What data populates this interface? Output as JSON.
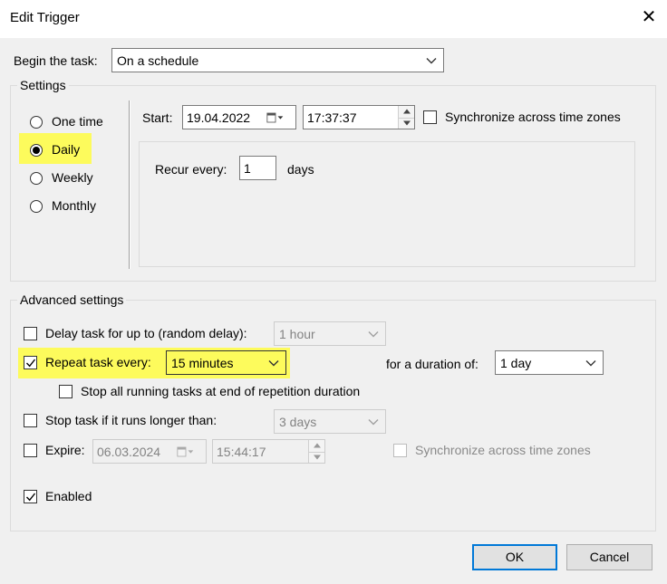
{
  "window": {
    "title": "Edit Trigger"
  },
  "begin": {
    "label": "Begin the task:",
    "value": "On a schedule"
  },
  "settings": {
    "group_label": "Settings",
    "options": [
      "One time",
      "Daily",
      "Weekly",
      "Monthly"
    ],
    "selected": "Daily",
    "start_label": "Start:",
    "start_date": "19.04.2022",
    "start_time": "17:37:37",
    "sync_label": "Synchronize across time zones",
    "recur_label": "Recur every:",
    "recur_value": "1",
    "recur_unit": "days"
  },
  "advanced": {
    "group_label": "Advanced settings",
    "delay_label": "Delay task for up to (random delay):",
    "delay_value": "1 hour",
    "repeat_label": "Repeat task every:",
    "repeat_value": "15 minutes",
    "duration_label": "for a duration of:",
    "duration_value": "1 day",
    "stop_running_label": "Stop all running tasks at end of repetition duration",
    "stop_longer_label": "Stop task if it runs longer than:",
    "stop_longer_value": "3 days",
    "expire_label": "Expire:",
    "expire_date": "06.03.2024",
    "expire_time": "15:44:17",
    "expire_sync_label": "Synchronize across time zones",
    "enabled_label": "Enabled"
  },
  "buttons": {
    "ok": "OK",
    "cancel": "Cancel"
  },
  "colors": {
    "highlight": "#fdfb5c",
    "accent": "#0078d7"
  }
}
